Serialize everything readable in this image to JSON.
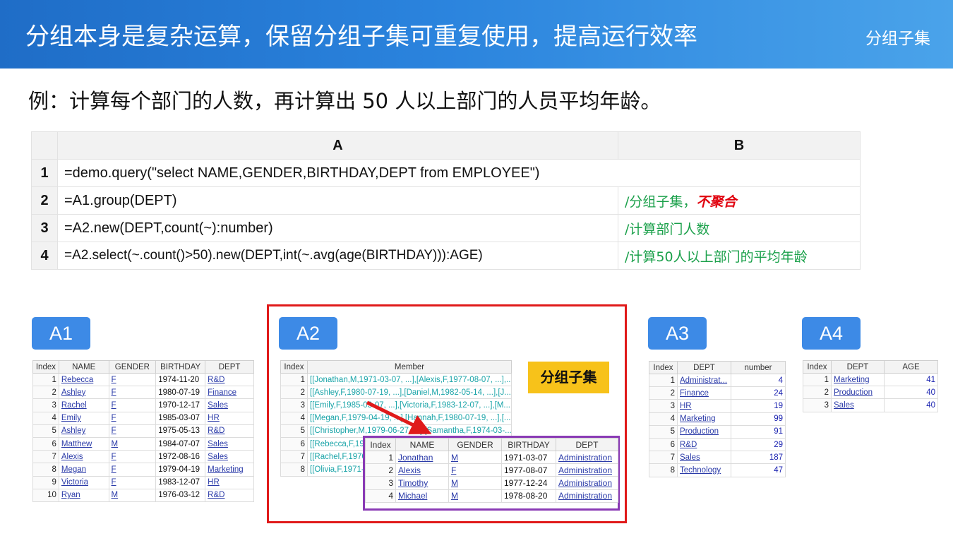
{
  "header": {
    "title": "分组本身是复杂运算，保留分组子集可重复使用，提高运行效率",
    "tag": "分组子集"
  },
  "subtitle": "例：计算每个部门的人数，再计算出 50 人以上部门的人员平均年龄。",
  "code": {
    "col_a": "A",
    "col_b": "B",
    "rows": [
      {
        "n": "1",
        "a": "=demo.query(\"select  NAME,GENDER,BIRTHDAY,DEPT  from EMPLOYEE\")",
        "b": "",
        "b_em": ""
      },
      {
        "n": "2",
        "a": "=A1.group(DEPT)",
        "b": "/分组子集，",
        "b_em": "不聚合"
      },
      {
        "n": "3",
        "a": "=A2.new(DEPT,count(~):number)",
        "b": "/计算部门人数",
        "b_em": ""
      },
      {
        "n": "4",
        "a": "=A2.select(~.count()>50).new(DEPT,int(~.avg(age(BIRTHDAY))):AGE)",
        "b": "/计算50人以上部门的平均年龄",
        "b_em": ""
      }
    ]
  },
  "labels": {
    "a1": "A1",
    "a2": "A2",
    "a3": "A3",
    "a4": "A4"
  },
  "badge": "分组子集",
  "a1": {
    "headers": [
      "Index",
      "NAME",
      "GENDER",
      "BIRTHDAY",
      "DEPT"
    ],
    "rows": [
      [
        "1",
        "Rebecca",
        "F",
        "1974-11-20",
        "R&D"
      ],
      [
        "2",
        "Ashley",
        "F",
        "1980-07-19",
        "Finance"
      ],
      [
        "3",
        "Rachel",
        "F",
        "1970-12-17",
        "Sales"
      ],
      [
        "4",
        "Emily",
        "F",
        "1985-03-07",
        "HR"
      ],
      [
        "5",
        "Ashley",
        "F",
        "1975-05-13",
        "R&D"
      ],
      [
        "6",
        "Matthew",
        "M",
        "1984-07-07",
        "Sales"
      ],
      [
        "7",
        "Alexis",
        "F",
        "1972-08-16",
        "Sales"
      ],
      [
        "8",
        "Megan",
        "F",
        "1979-04-19",
        "Marketing"
      ],
      [
        "9",
        "Victoria",
        "F",
        "1983-12-07",
        "HR"
      ],
      [
        "10",
        "Ryan",
        "M",
        "1976-03-12",
        "R&D"
      ]
    ]
  },
  "a2": {
    "headers": [
      "Index",
      "Member"
    ],
    "rows": [
      [
        "1",
        "[[Jonathan,M,1971-03-07, ...],[Alexis,F,1977-08-07, ...],..."
      ],
      [
        "2",
        "[[Ashley,F,1980-07-19, ...],[Daniel,M,1982-05-14, ...],[J..."
      ],
      [
        "3",
        "[[Emily,F,1985-03-07, ...],[Victoria,F,1983-12-07, ...],[M..."
      ],
      [
        "4",
        "[[Megan,F,1979-04-19, ...],[Hannah,F,1980-07-19, ...],[..."
      ],
      [
        "5",
        "[[Christopher,M,1979-06-27, ...],[Samantha,F,1974-03-..."
      ],
      [
        "6",
        "[[Rebecca,F,1974-11-20, ...],..."
      ],
      [
        "7",
        "[[Rachel,F,1970-12-17, ...],..."
      ],
      [
        "8",
        "[[Olivia,F,1971-..."
      ]
    ]
  },
  "a2_sub": {
    "headers": [
      "Index",
      "NAME",
      "GENDER",
      "BIRTHDAY",
      "DEPT"
    ],
    "rows": [
      [
        "1",
        "Jonathan",
        "M",
        "1971-03-07",
        "Administration"
      ],
      [
        "2",
        "Alexis",
        "F",
        "1977-08-07",
        "Administration"
      ],
      [
        "3",
        "Timothy",
        "M",
        "1977-12-24",
        "Administration"
      ],
      [
        "4",
        "Michael",
        "M",
        "1978-08-20",
        "Administration"
      ]
    ]
  },
  "a3": {
    "headers": [
      "Index",
      "DEPT",
      "number"
    ],
    "rows": [
      [
        "1",
        "Administrat...",
        "4"
      ],
      [
        "2",
        "Finance",
        "24"
      ],
      [
        "3",
        "HR",
        "19"
      ],
      [
        "4",
        "Marketing",
        "99"
      ],
      [
        "5",
        "Production",
        "91"
      ],
      [
        "6",
        "R&D",
        "29"
      ],
      [
        "7",
        "Sales",
        "187"
      ],
      [
        "8",
        "Technology",
        "47"
      ]
    ]
  },
  "a4": {
    "headers": [
      "Index",
      "DEPT",
      "AGE"
    ],
    "rows": [
      [
        "1",
        "Marketing",
        "41"
      ],
      [
        "2",
        "Production",
        "40"
      ],
      [
        "3",
        "Sales",
        "40"
      ]
    ]
  },
  "colors": {
    "header_blue": "#1f6dc7",
    "label_blue": "#3d8ae6",
    "red_box": "#e01a1a",
    "purple_box": "#8a3ab5",
    "badge_yellow": "#f7c21a",
    "comment_green": "#1aa04a"
  }
}
